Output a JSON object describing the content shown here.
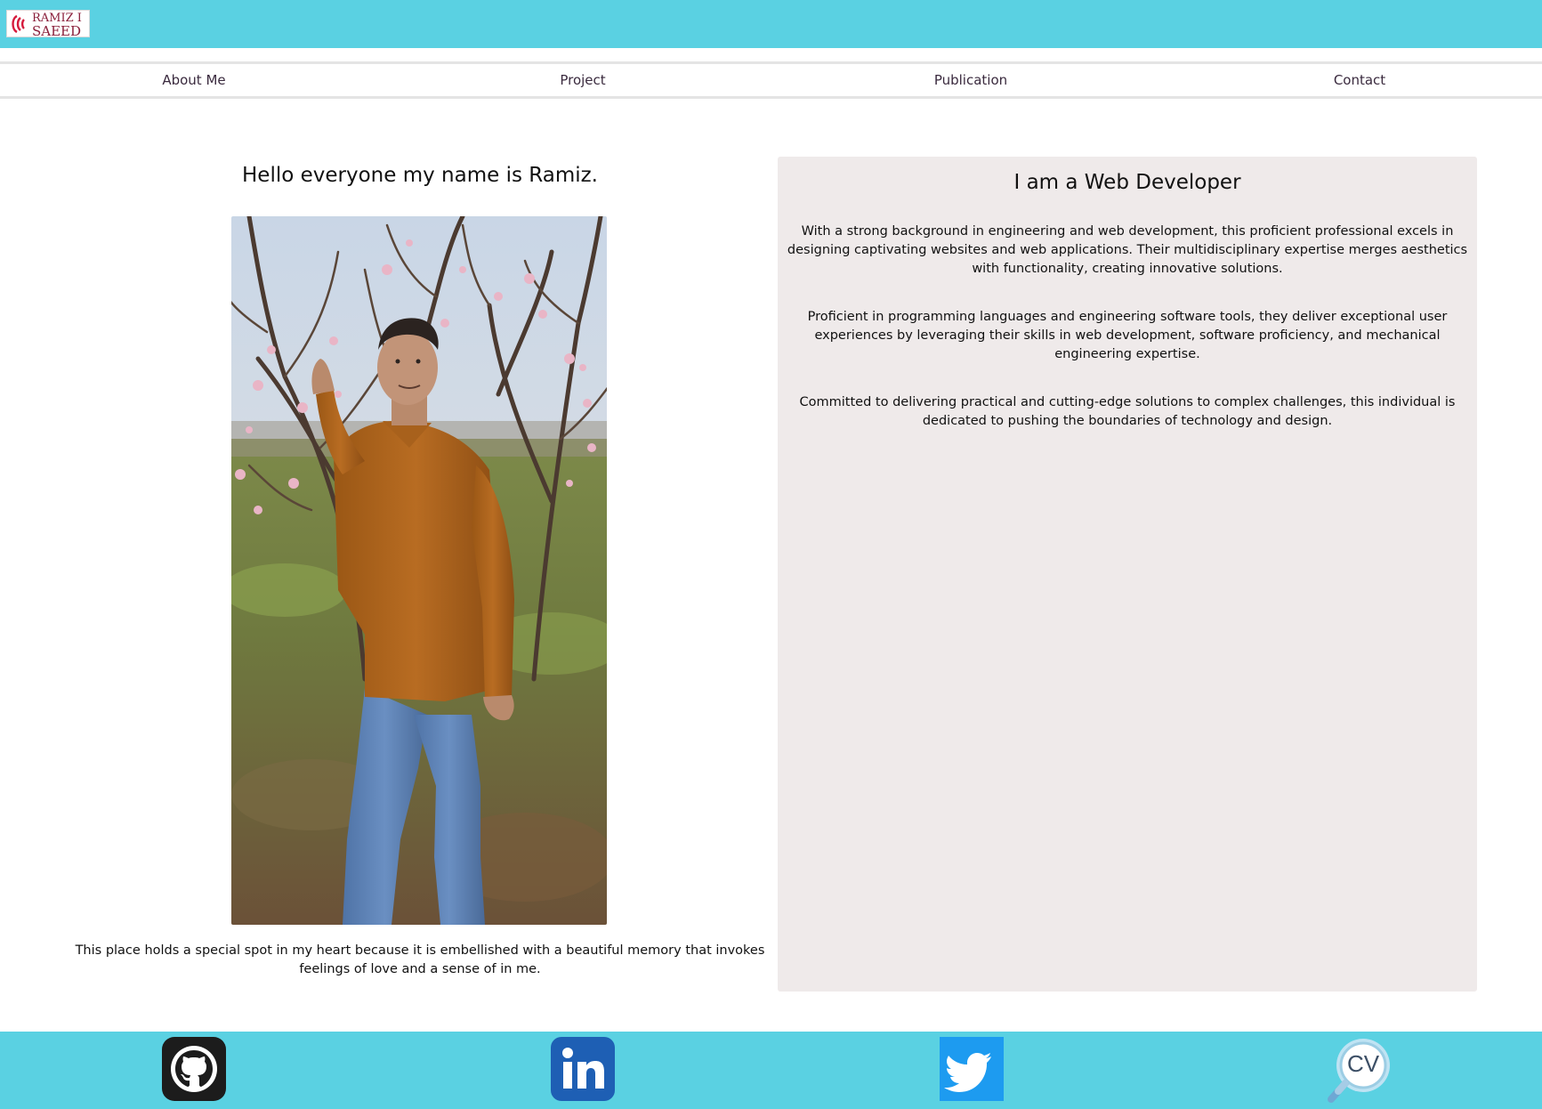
{
  "header": {
    "logo": {
      "line1": "RAMIZ I",
      "line2": "SAEED"
    },
    "colors": {
      "bar": "#5ad1e2",
      "logo_accent": "#d61a3c"
    }
  },
  "nav": {
    "items": [
      {
        "label": "About Me"
      },
      {
        "label": "Project"
      },
      {
        "label": "Publication"
      },
      {
        "label": "Contact"
      }
    ]
  },
  "intro": {
    "greeting": "Hello everyone my name is Ramiz.",
    "photo_icon": "portrait-photo",
    "caption": "This place holds a special spot in my heart because it is embellished with a beautiful memory that invokes feelings of love and a sense of in me."
  },
  "about": {
    "title": "I am a Web Developer",
    "paragraphs": [
      "With a strong background in engineering and web development, this proficient professional excels in designing captivating websites and web applications. Their multidisciplinary expertise merges aesthetics with functionality, creating innovative solutions.",
      "Proficient in programming languages and engineering software tools, they deliver exceptional user experiences by leveraging their skills in web development, software proficiency, and mechanical engineering expertise.",
      "Committed to delivering practical and cutting-edge solutions to complex challenges, this individual is dedicated to pushing the boundaries of technology and design."
    ],
    "panel_color": "#efeaea"
  },
  "footer": {
    "links": [
      {
        "icon": "github-icon"
      },
      {
        "icon": "linkedin-icon"
      },
      {
        "icon": "twitter-icon"
      },
      {
        "icon": "cv-icon",
        "text": "CV"
      }
    ]
  }
}
